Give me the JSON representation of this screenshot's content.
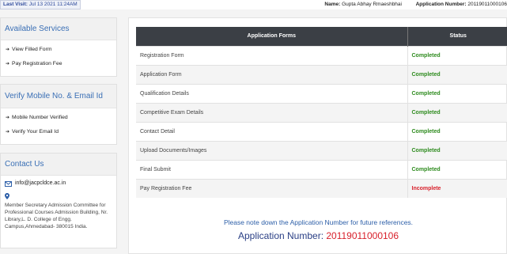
{
  "header": {
    "last_visit_label": "Last Visit:",
    "last_visit_value": "Jul 13 2021 11:24AM",
    "name_label": "Name:",
    "name_value": "Gupta Abhay Rmaeshbhai",
    "appno_label": "Application Number:",
    "appno_value": "20119011000106"
  },
  "sidebar": {
    "services": {
      "title": "Available Services",
      "items": [
        {
          "label": "View Filled Form"
        },
        {
          "label": "Pay Registration Fee"
        }
      ]
    },
    "verify": {
      "title": "Verify Mobile No. & Email Id",
      "items": [
        {
          "label": "Mobile Number Verified"
        },
        {
          "label": "Verify Your Email Id"
        }
      ]
    },
    "contact": {
      "title": "Contact Us",
      "email": "info@jacpcldce.ac.in",
      "address": "Member Secretary Admission Committee for Professional Courses Admission Building, Nr. Library,L. D. College of Engg. Campus,Ahmedabad- 380015 India."
    }
  },
  "table": {
    "headers": [
      "Application Forms",
      "Status"
    ],
    "rows": [
      {
        "form": "Registration Form",
        "status": "Completed"
      },
      {
        "form": "Application Form",
        "status": "Completed"
      },
      {
        "form": "Qualification Details",
        "status": "Completed"
      },
      {
        "form": "Competitive Exam Details",
        "status": "Completed"
      },
      {
        "form": "Contact Detail",
        "status": "Completed"
      },
      {
        "form": "Upload Documents/Images",
        "status": "Completed"
      },
      {
        "form": "Final Submit",
        "status": "Completed"
      },
      {
        "form": "Pay Registration Fee",
        "status": "Incomplete"
      }
    ]
  },
  "footer": {
    "note": "Please note down the Application Number for future references.",
    "appno_label": "Application Number:",
    "appno_value": "20119011000106"
  },
  "colors": {
    "completed": "#2e8b1e",
    "incomplete": "#d81f2a",
    "accent": "#3a6fb5",
    "table_header": "#3b3f45"
  }
}
